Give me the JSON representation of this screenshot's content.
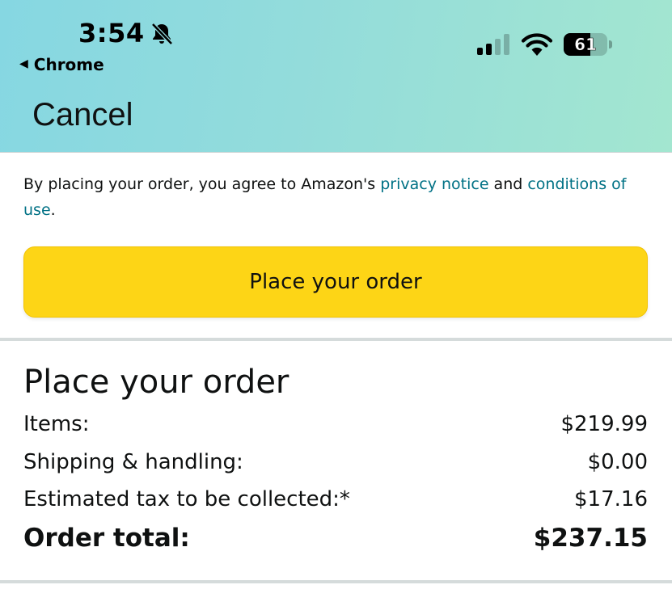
{
  "status_bar": {
    "time": "3:54",
    "back_app": "Chrome",
    "battery_level": "61",
    "battery_fraction": 0.61,
    "icons": [
      "bell-slash-icon",
      "cellular-signal-icon",
      "wifi-icon",
      "battery-icon"
    ]
  },
  "header": {
    "cancel_label": "Cancel"
  },
  "agreement": {
    "prefix": "By placing your order, you agree to Amazon's ",
    "privacy_link": "privacy notice",
    "middle": " and ",
    "conditions_link": "conditions of use",
    "suffix": "."
  },
  "place_order_button": "Place your order",
  "summary": {
    "title": "Place your order",
    "rows": [
      {
        "label": "Items:",
        "value": "$219.99"
      },
      {
        "label": "Shipping & handling:",
        "value": "$0.00"
      },
      {
        "label": "Estimated tax to be collected:*",
        "value": "$17.16"
      }
    ],
    "total": {
      "label": "Order total:",
      "value": "$237.15"
    }
  },
  "colors": {
    "button": "#fdd516",
    "link": "#007185",
    "header_gradient_start": "#86d7e2",
    "header_gradient_end": "#a3e6d0"
  }
}
